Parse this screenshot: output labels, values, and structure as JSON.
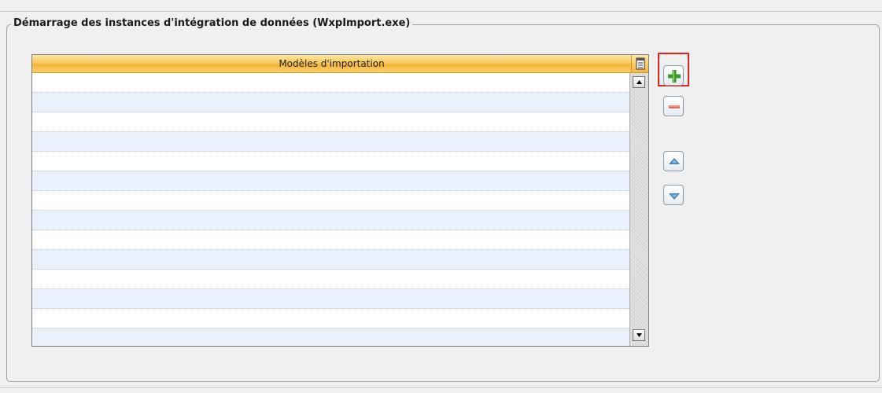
{
  "group": {
    "title": "Démarrage des instances d'intégration de données (WxpImport.exe)"
  },
  "table": {
    "column_header": "Modèles d'importation",
    "rows": []
  },
  "icons": {
    "header_menu": "column-menu-icon",
    "add": "plus-icon",
    "remove": "minus-icon",
    "move_up": "arrow-up-icon",
    "move_down": "arrow-down-icon"
  },
  "colors": {
    "header_orange": "#f4b53c",
    "row_alt": "#e9f2fc",
    "highlight_red": "#e0241c",
    "plus_green": "#3d9b2a",
    "minus_red": "#e06a5a",
    "arrow_blue": "#3f7fb6"
  }
}
